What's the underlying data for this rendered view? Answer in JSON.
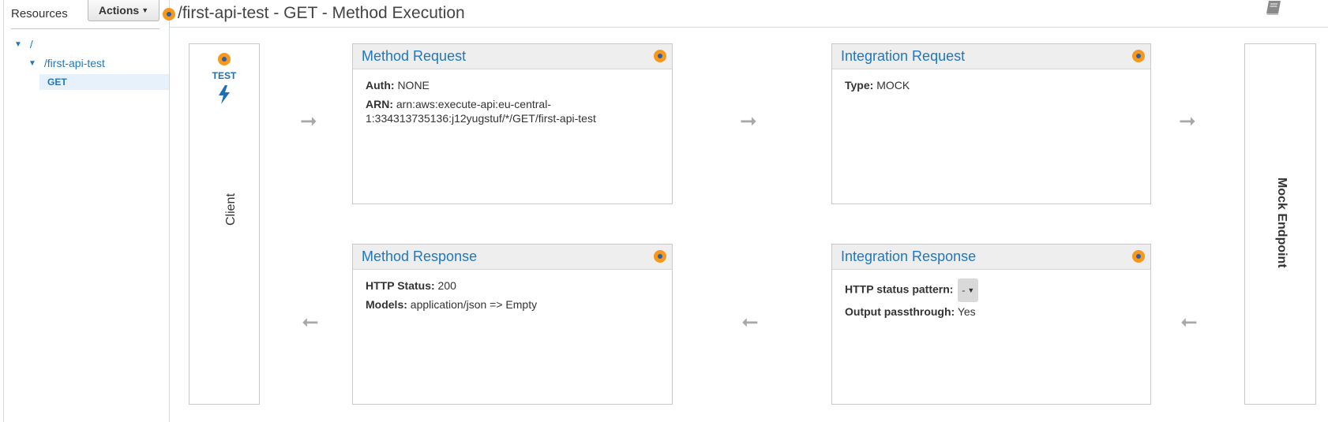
{
  "sidebar": {
    "resources_label": "Resources",
    "actions_label": "Actions",
    "tree": {
      "root": "/",
      "resource": "/first-api-test",
      "method": "GET"
    }
  },
  "header": {
    "title": "/first-api-test - GET - Method Execution"
  },
  "client": {
    "test_label": "TEST",
    "label": "Client"
  },
  "method_request": {
    "title": "Method Request",
    "auth_label": "Auth:",
    "auth_value": "NONE",
    "arn_label": "ARN:",
    "arn_value": "arn:aws:execute-api:eu-central-1:334313735136:j12yugstuf/*/GET/first-api-test"
  },
  "integration_request": {
    "title": "Integration Request",
    "type_label": "Type:",
    "type_value": "MOCK"
  },
  "method_response": {
    "title": "Method Response",
    "status_label": "HTTP Status:",
    "status_value": "200",
    "models_label": "Models:",
    "models_value": "application/json => Empty"
  },
  "integration_response": {
    "title": "Integration Response",
    "pattern_label": "HTTP status pattern:",
    "pattern_value": "-",
    "passthrough_label": "Output passthrough:",
    "passthrough_value": "Yes"
  },
  "mock_endpoint": {
    "label": "Mock Endpoint"
  },
  "colors": {
    "link_blue": "#1f77c1",
    "badge_orange": "#f7981d",
    "panel_header_bg": "#eeeeee",
    "arrow_gray": "#a8a8a8"
  },
  "icons": [
    "caret-down-icon",
    "status-dot-icon",
    "lightning-bolt-icon",
    "book-icon",
    "arrow-right-icon",
    "arrow-left-icon"
  ]
}
